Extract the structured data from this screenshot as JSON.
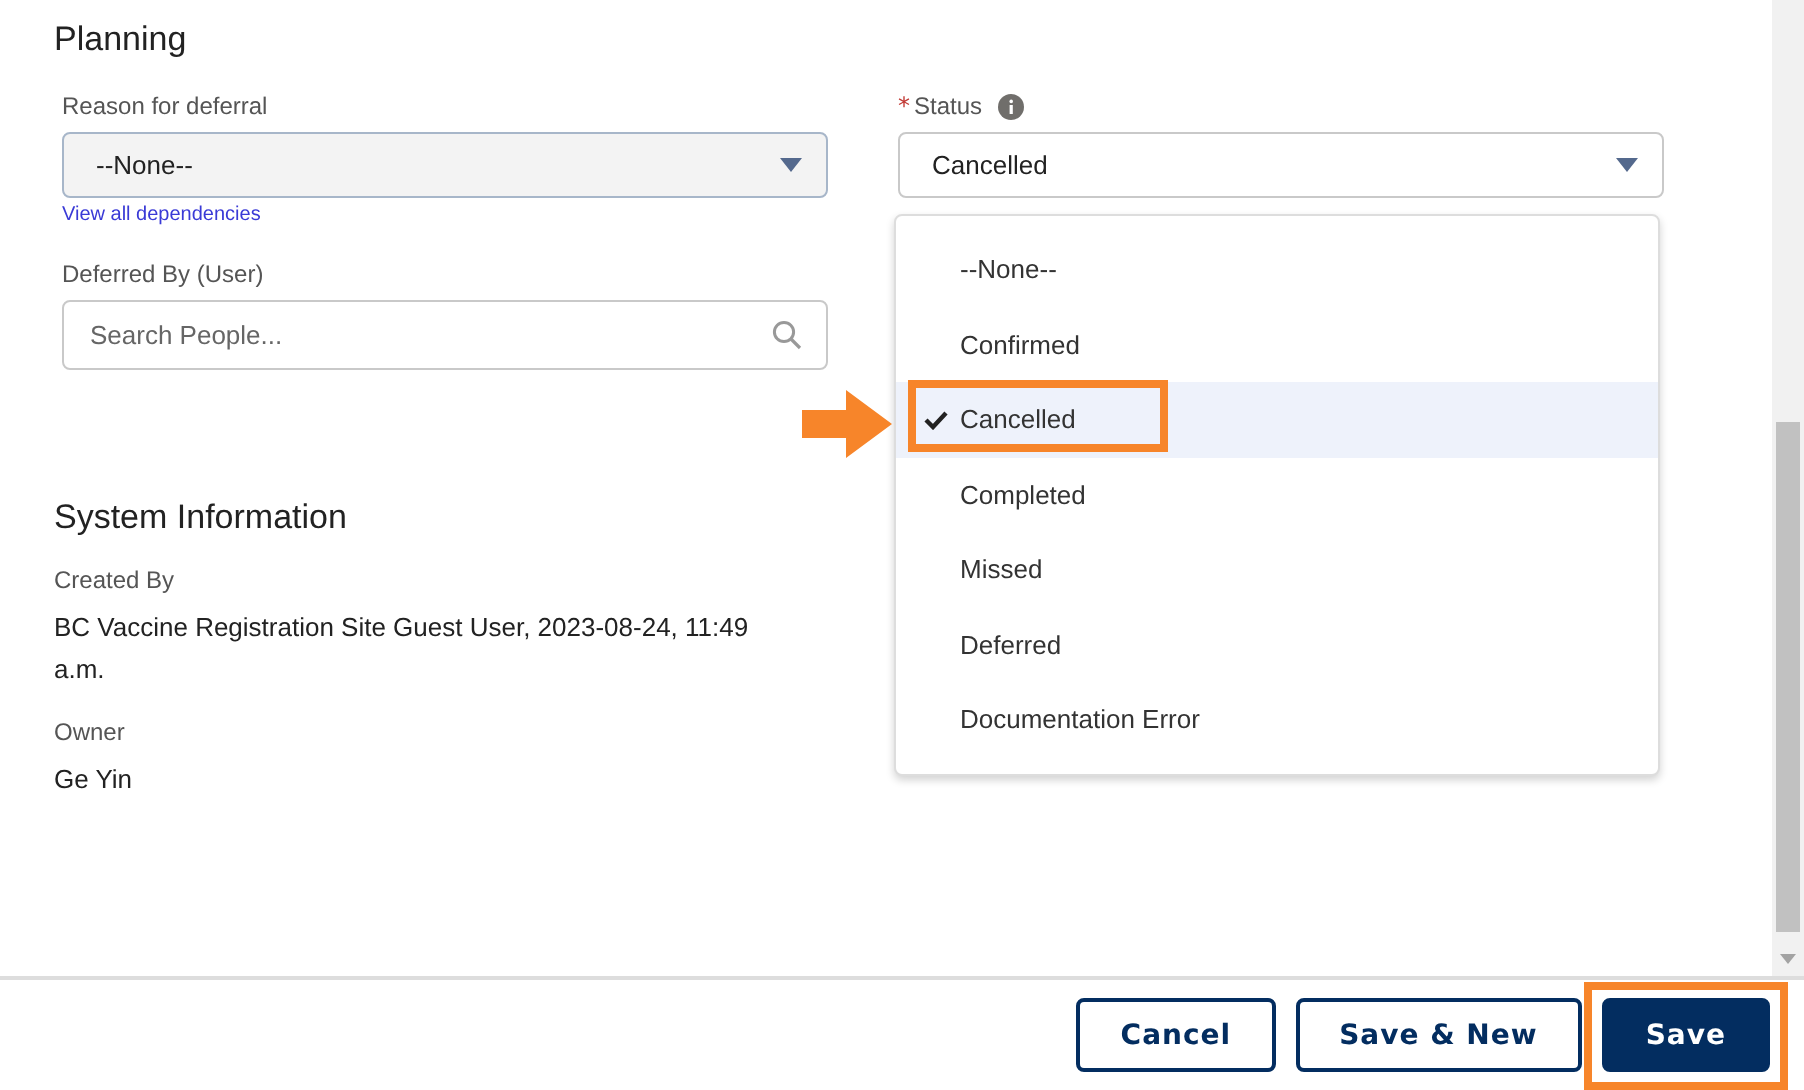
{
  "planning": {
    "title": "Planning",
    "reason_for_deferral": {
      "label": "Reason for deferral",
      "value": "--None--",
      "disabled": true,
      "link": "View all dependencies"
    },
    "deferred_by": {
      "label": "Deferred By (User)",
      "placeholder": "Search People..."
    },
    "status": {
      "label": "Status",
      "required_mark": "*",
      "value": "Cancelled",
      "expanded": true,
      "options": [
        {
          "label": "--None--",
          "selected": false
        },
        {
          "label": "Confirmed",
          "selected": false
        },
        {
          "label": "Cancelled",
          "selected": true
        },
        {
          "label": "Completed",
          "selected": false
        },
        {
          "label": "Missed",
          "selected": false
        },
        {
          "label": "Deferred",
          "selected": false
        },
        {
          "label": "Documentation Error",
          "selected": false
        }
      ]
    }
  },
  "system_information": {
    "title": "System Information",
    "fields": [
      {
        "label": "Created By",
        "value": "BC Vaccine Registration Site Guest User, 2023-08-24, 11:49 a.m."
      },
      {
        "label": "Owner",
        "value": "Ge Yin"
      }
    ]
  },
  "footer": {
    "buttons": [
      {
        "label": "Cancel",
        "kind": "outline"
      },
      {
        "label": "Save & New",
        "kind": "outline"
      },
      {
        "label": "Save",
        "kind": "brand"
      }
    ]
  }
}
